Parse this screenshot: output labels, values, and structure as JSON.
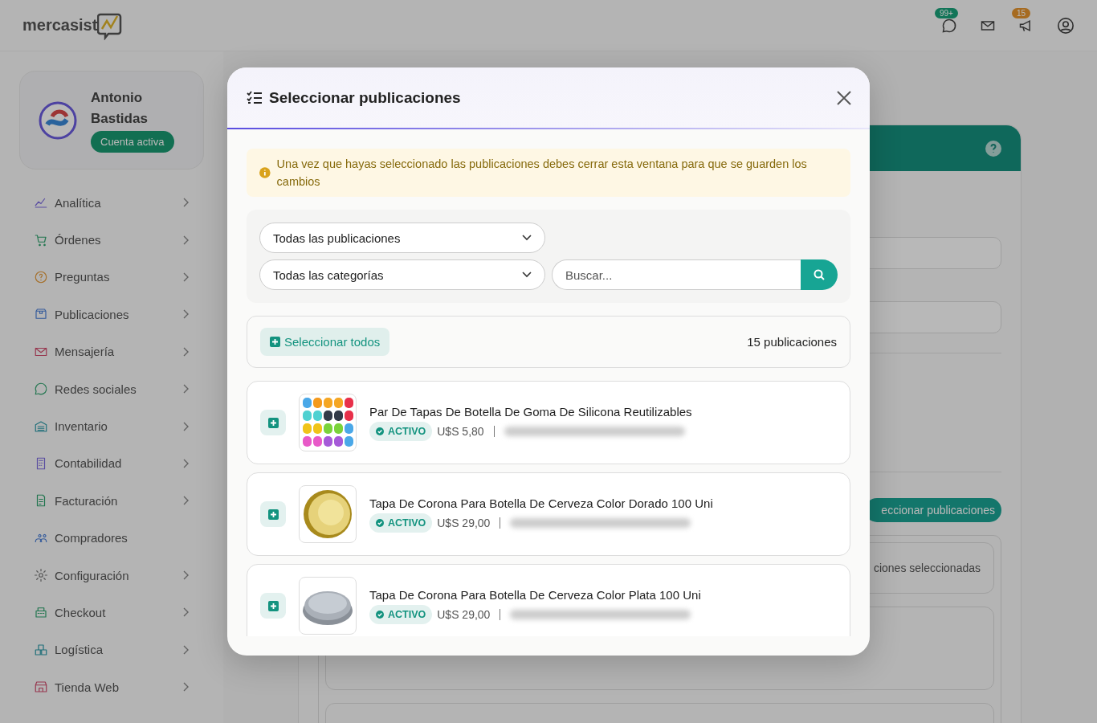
{
  "topbar": {
    "logo": "mercasist",
    "icons": [
      {
        "kind": "whatsapp",
        "badge": "99+"
      },
      {
        "kind": "mail"
      },
      {
        "kind": "megaphone",
        "badge": "15"
      },
      {
        "kind": "user"
      }
    ]
  },
  "profile": {
    "name": "Antonio Bastidas",
    "status": "Cuenta activa"
  },
  "sidebar": {
    "items": [
      {
        "label": "Analítica",
        "has_submenu": true
      },
      {
        "label": "Órdenes",
        "has_submenu": true
      },
      {
        "label": "Preguntas",
        "has_submenu": true
      },
      {
        "label": "Publicaciones",
        "has_submenu": true
      },
      {
        "label": "Mensajería",
        "has_submenu": true
      },
      {
        "label": "Redes sociales",
        "has_submenu": true
      },
      {
        "label": "Inventario",
        "has_submenu": true
      },
      {
        "label": "Contabilidad",
        "has_submenu": true
      },
      {
        "label": "Facturación",
        "has_submenu": true
      },
      {
        "label": "Compradores",
        "has_submenu": false
      },
      {
        "label": "Configuración",
        "has_submenu": true
      },
      {
        "label": "Checkout",
        "has_submenu": true
      },
      {
        "label": "Logística",
        "has_submenu": true
      },
      {
        "label": "Tienda Web",
        "has_submenu": true
      }
    ]
  },
  "background": {
    "select_button": "eccionar publicaciones",
    "selected_label": "ciones seleccionadas"
  },
  "modal": {
    "title": "Seleccionar publicaciones",
    "notice": "Una vez que hayas seleccionado las publicaciones debes cerrar esta ventana para que se guarden los cambios",
    "filters": {
      "publications": "Todas las publicaciones",
      "categories": "Todas las categorías",
      "search": {
        "placeholder": "Buscar..."
      }
    },
    "select_all": "Seleccionar todos",
    "count": "15 publicaciones",
    "items": [
      {
        "title": "Par De Tapas De Botella De Goma De Silicona Reutilizables",
        "status": "ACTIVO",
        "price": "U$S 5,80"
      },
      {
        "title": "Tapa De Corona Para Botella De Cerveza Color Dorado 100 Uni",
        "status": "ACTIVO",
        "price": "U$S 29,00"
      },
      {
        "title": "Tapa De Corona Para Botella De Cerveza Color Plata 100 Uni",
        "status": "ACTIVO",
        "price": "U$S 29,00"
      }
    ]
  }
}
